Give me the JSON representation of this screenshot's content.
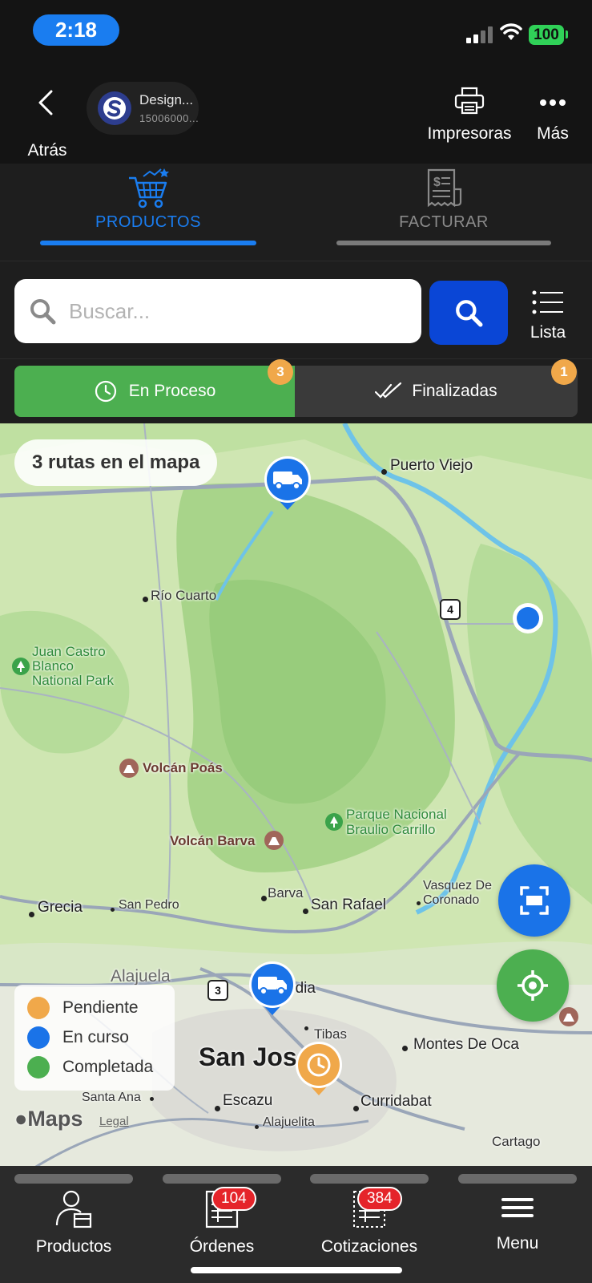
{
  "status_bar": {
    "time": "2:18",
    "battery": "100"
  },
  "header": {
    "back_label": "Atrás",
    "store_name": "Design...",
    "store_id": "15006000...",
    "printers_label": "Impresoras",
    "more_label": "Más"
  },
  "tabs": [
    {
      "label": "PRODUCTOS",
      "active": true,
      "icon": "shopping-cart-icon"
    },
    {
      "label": "FACTURAR",
      "active": false,
      "icon": "receipt-icon"
    }
  ],
  "search": {
    "placeholder": "Buscar...",
    "value": "",
    "list_label": "Lista"
  },
  "segment": {
    "in_progress": {
      "label": "En Proceso",
      "count": "3"
    },
    "finished": {
      "label": "Finalizadas",
      "count": "1"
    }
  },
  "map": {
    "routes_summary": "3 rutas en el mapa",
    "labels": {
      "puerto_viejo": "Puerto Viejo",
      "rio_cuarto": "Río Cuarto",
      "juan_castro": "Juan Castro",
      "blanco": "Blanco",
      "national_park": "National Park",
      "volcan_poas": "Volcán Poás",
      "parque_nacional": "Parque Nacional",
      "braulio_carrillo": "Braulio Carrillo",
      "volcan_barva": "Volcán Barva",
      "barva": "Barva",
      "grecia": "Grecia",
      "san_pedro": "San Pedro",
      "san_rafael": "San Rafael",
      "vasquez_de": "Vasquez De",
      "coronado": "Coronado",
      "alajuela": "Alajuela",
      "heredia": "edia",
      "tibas": "Tibas",
      "san_jose": "San Jos",
      "montes_de_oca": "Montes De Oca",
      "santa_ana": "Santa Ana",
      "escazu": "Escazu",
      "curridabat": "Curridabat",
      "alajuelita": "Alajuelita",
      "cartago": "Cartago"
    },
    "road_shields": {
      "r4": "4",
      "r3": "3"
    },
    "legend": [
      {
        "label": "Pendiente",
        "color": "#f0a84a"
      },
      {
        "label": "En curso",
        "color": "#1a73e8"
      },
      {
        "label": "Completada",
        "color": "#4caf50"
      }
    ],
    "brand": "Maps",
    "legal": "Legal"
  },
  "bottom_nav": {
    "products_label": "Productos",
    "orders_label": "Órdenes",
    "orders_badge": "104",
    "quotes_label": "Cotizaciones",
    "quotes_badge": "384",
    "menu_label": "Menu"
  }
}
